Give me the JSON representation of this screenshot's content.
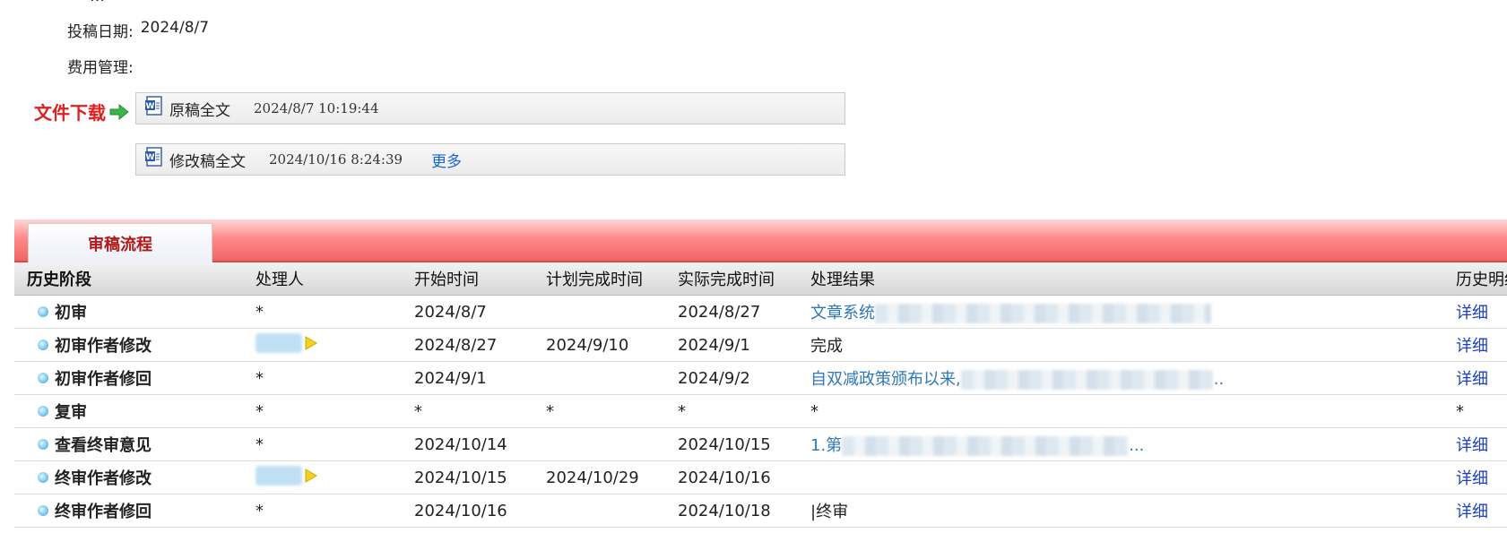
{
  "meta": {
    "submit_date_label": "投稿日期:",
    "submit_date_value": "2024/8/7",
    "fee_label": "费用管理:"
  },
  "download": {
    "label": "文件下载",
    "files": [
      {
        "name": "原稿全文",
        "date": "2024/8/7 10:19:44"
      },
      {
        "name": "修改稿全文",
        "date": "2024/10/16 8:24:39",
        "more": "更多"
      }
    ]
  },
  "tab": {
    "label": "审稿流程"
  },
  "table": {
    "headers": [
      "历史阶段",
      "处理人",
      "开始时间",
      "计划完成时间",
      "实际完成时间",
      "处理结果",
      "历史明细"
    ],
    "rows": [
      {
        "stage": "初审",
        "handler": "*",
        "start": "2024/8/7",
        "plan": "",
        "actual": "2024/8/27",
        "result": "文章系统",
        "result_link": true,
        "detail": "详细"
      },
      {
        "stage": "初审作者修改",
        "handler": "",
        "start": "2024/8/27",
        "plan": "2024/9/10",
        "actual": "2024/9/1",
        "result": "完成",
        "result_link": false,
        "detail": "详细"
      },
      {
        "stage": "初审作者修回",
        "handler": "*",
        "start": "2024/9/1",
        "plan": "",
        "actual": "2024/9/2",
        "result": "自双减政策颁布以来,",
        "result_link": true,
        "detail": "详细"
      },
      {
        "stage": "复审",
        "handler": "*",
        "start": "*",
        "plan": "*",
        "actual": "*",
        "result": "*",
        "result_link": false,
        "detail": "*"
      },
      {
        "stage": "查看终审意见",
        "handler": "*",
        "start": "2024/10/14",
        "plan": "",
        "actual": "2024/10/15",
        "result": "1.第",
        "result_link": true,
        "detail": "详细"
      },
      {
        "stage": "终审作者修改",
        "handler": "",
        "start": "2024/10/15",
        "plan": "2024/10/29",
        "actual": "2024/10/16",
        "result": "",
        "result_link": false,
        "detail": "详细"
      },
      {
        "stage": "终审作者修回",
        "handler": "*",
        "start": "2024/10/16",
        "plan": "",
        "actual": "2024/10/18",
        "result": "|终审",
        "result_link": false,
        "detail": "详细"
      }
    ]
  },
  "colors": {
    "download_label": "#e02020",
    "tab_text": "#b21a1a",
    "link": "#2e78b7",
    "detail_link": "#1a3fc4"
  }
}
